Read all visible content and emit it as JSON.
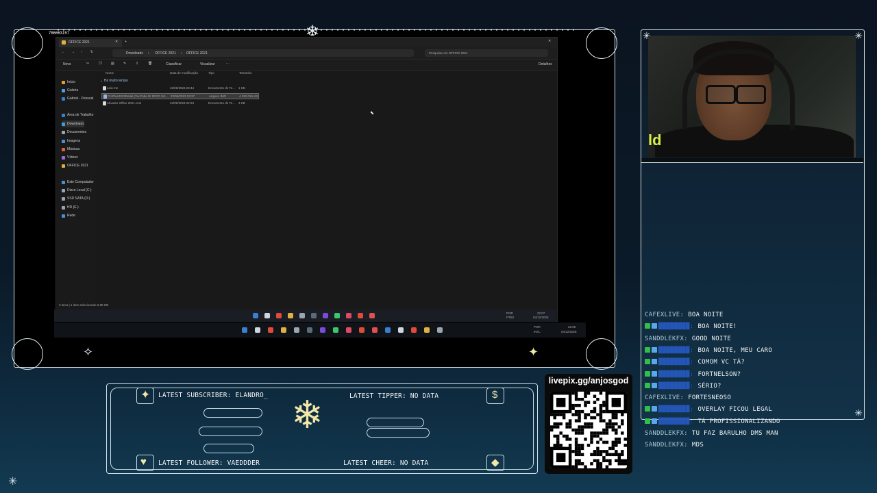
{
  "remote_explorer": {
    "window_title_number": "786663157",
    "tab_title": "OFFICE 2021",
    "breadcrumb": [
      "Downloads",
      "OFFICE 2021",
      "OFFICE 2021"
    ],
    "search_placeholder": "Pesquisar em OFFICE 2021",
    "toolbar": {
      "new": "Novo",
      "sort": "Classificar",
      "view": "Visualizar",
      "more": "···",
      "details": "Detalhes"
    },
    "columns": [
      "Nome",
      "Data de modificação",
      "Tipo",
      "Tamanho"
    ],
    "group_label": "Há muito tempo",
    "files": [
      {
        "name": "Leia-me",
        "date": "22/06/2023 23:44",
        "type": "Documento de Te...",
        "size": "1 KB",
        "color": "#d9d9d9"
      },
      {
        "name": "ProPlus2021Retail (YouTube Dr DIGO Sct...",
        "date": "22/06/2023 23:37",
        "type": "Arquivo IMG",
        "size": "4.152.016 KB",
        "color": "#8fb6e6"
      },
      {
        "name": "Ativador Office 2021.cmd",
        "date": "22/06/2023 22:23",
        "type": "Documento de Te...",
        "size": "3 KB",
        "color": "#d9d9d9"
      }
    ],
    "nav_items": [
      {
        "label": "Início",
        "color": "#e0a030"
      },
      {
        "label": "Galeria",
        "color": "#4aa3df"
      },
      {
        "label": "Gabriel - Pessoal",
        "color": "#3a7fd0"
      },
      {
        "label": "Área de Trabalho",
        "color": "#3a7fd0"
      },
      {
        "label": "Downloads",
        "color": "#3aa0d8"
      },
      {
        "label": "Documentos",
        "color": "#9aa6b3"
      },
      {
        "label": "Imagens",
        "color": "#4a90d8"
      },
      {
        "label": "Músicas",
        "color": "#e0603a"
      },
      {
        "label": "Vídeos",
        "color": "#9a6ad8"
      },
      {
        "label": "OFFICE 2021",
        "color": "#e0b040"
      },
      {
        "label": "Este Computador",
        "color": "#4a90d8"
      },
      {
        "label": "Disco Local (C:)",
        "color": "#9aa6b3"
      },
      {
        "label": "SSD SATA (D:)",
        "color": "#9aa6b3"
      },
      {
        "label": "HD (E:)",
        "color": "#9aa6b3"
      },
      {
        "label": "Rede",
        "color": "#4a90d8"
      }
    ],
    "status": "3 itens  |  1 item selecionado  2,98 GB",
    "inner_tray": {
      "lang": "POR",
      "layout": "PTB2",
      "time": "22:07",
      "date": "04/12/2025"
    },
    "outer_tray": {
      "lang": "POR",
      "layout": "INTL",
      "time": "22:06",
      "date": "04/12/2025"
    }
  },
  "chat": [
    {
      "user": "CAFEXLIVE:",
      "msg": "BOA NOITE",
      "user_color": "light",
      "badges": false
    },
    {
      "user": "████████:",
      "msg": "BOA NOITE!",
      "user_color": "blue",
      "badges": true
    },
    {
      "user": "SANDDLEKFX:",
      "msg": "GOOD NOITE",
      "user_color": "light",
      "badges": false
    },
    {
      "user": "████████:",
      "msg": "BOA NOITE, MEU CARO",
      "user_color": "blue",
      "badges": true
    },
    {
      "user": "████████:",
      "msg": "COMOM VC TÁ?",
      "user_color": "blue",
      "badges": true
    },
    {
      "user": "████████:",
      "msg": "FORTNELSON?",
      "user_color": "blue",
      "badges": true
    },
    {
      "user": "████████:",
      "msg": "SÉRIO?",
      "user_color": "blue",
      "badges": true
    },
    {
      "user": "CAFEXLIVE:",
      "msg": "FORTESNEOSO",
      "user_color": "light",
      "badges": false
    },
    {
      "user": "████████:",
      "msg": "OVERLAY FICOU LEGAL",
      "user_color": "blue",
      "badges": true
    },
    {
      "user": "████████:",
      "msg": "TÁ PROFISSIONALIZANDO",
      "user_color": "blue",
      "badges": true
    },
    {
      "user": "SANDDLEKFX:",
      "msg": "TU FAZ BARULHO DMS MAN",
      "user_color": "light",
      "badges": false
    },
    {
      "user": "SANDDLEKFX:",
      "msg": "MDS",
      "user_color": "light",
      "badges": false
    }
  ],
  "stats": {
    "latest_subscriber": "LATEST SUBSCRIBER: ELANDRO_",
    "latest_tipper": "LATEST TIPPER: NO DATA",
    "latest_follower": "LATEST FOLLOWER: VAEDDDER",
    "latest_cheer": "LATEST CHEER: NO DATA"
  },
  "livepix": {
    "url": "livepix.gg/anjosgod"
  },
  "colors": {
    "frame": "#d8e4ea",
    "accent_gold": "#f2e7a8",
    "chat_blue_user": "#2456b8"
  }
}
